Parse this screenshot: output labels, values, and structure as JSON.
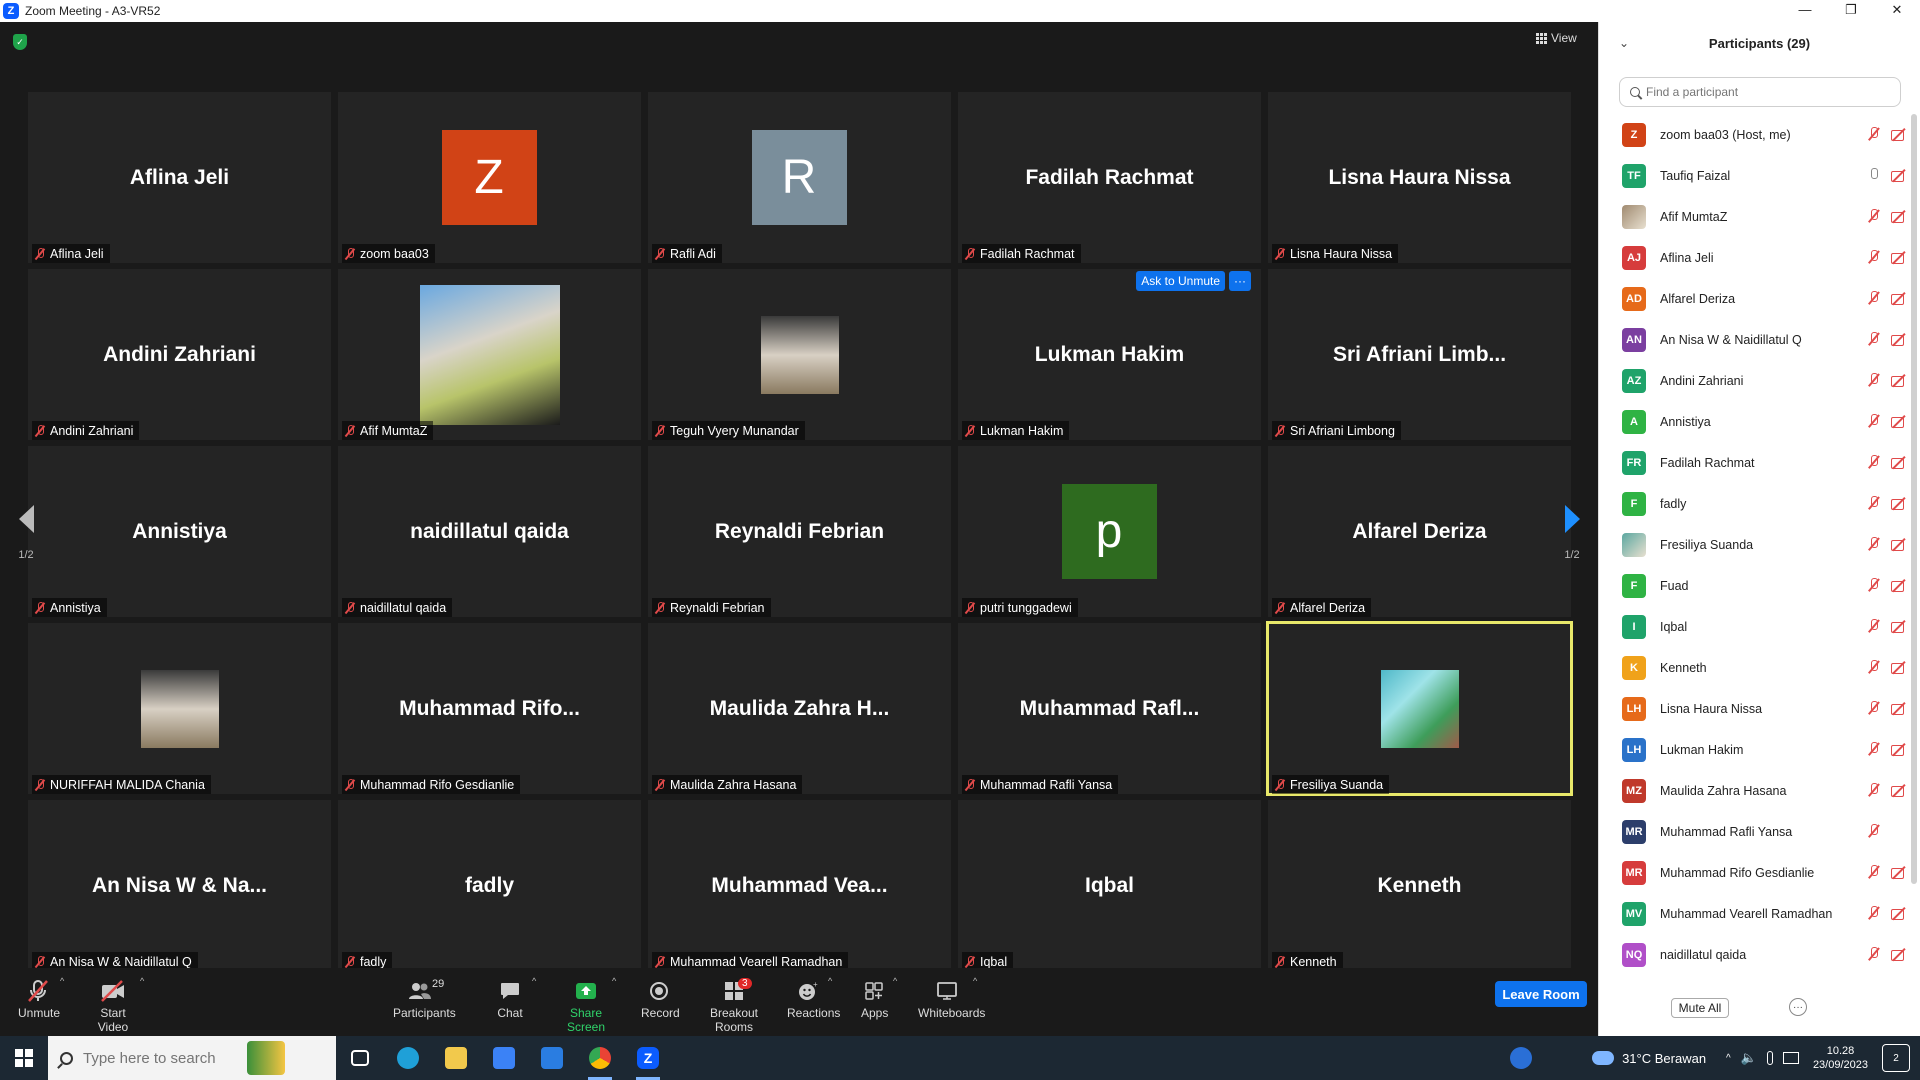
{
  "window": {
    "title": "Zoom Meeting - A3-VR52",
    "controls": [
      "—",
      "❐",
      "✕"
    ]
  },
  "view_label": "View",
  "tiles": [
    {
      "display": "Aflina Jeli",
      "label": "Aflina Jeli",
      "kind": "text"
    },
    {
      "display": "Z",
      "label": "zoom baa03",
      "kind": "avatar",
      "color": "#d14316"
    },
    {
      "display": "R",
      "label": "Rafli Adi",
      "kind": "avatar",
      "color": "#7a8e9b"
    },
    {
      "display": "Fadilah Rachmat",
      "label": "Fadilah Rachmat",
      "kind": "text"
    },
    {
      "display": "Lisna Haura Nissa",
      "label": "Lisna Haura Nissa",
      "kind": "text"
    },
    {
      "display": "Andini Zahriani",
      "label": "Andini Zahriani",
      "kind": "text"
    },
    {
      "display": "",
      "label": "Afif MumtaZ",
      "kind": "photo-large"
    },
    {
      "display": "",
      "label": "Teguh Vyery Munandar",
      "kind": "photo"
    },
    {
      "display": "Lukman Hakim",
      "label": "Lukman Hakim",
      "kind": "text",
      "ask": true
    },
    {
      "display": "Sri  Afriani  Limb...",
      "label": "Sri Afriani Limbong",
      "kind": "text"
    },
    {
      "display": "Annistiya",
      "label": "Annistiya",
      "kind": "text"
    },
    {
      "display": "naidillatul qaida",
      "label": "naidillatul qaida",
      "kind": "text"
    },
    {
      "display": "Reynaldi Febrian",
      "label": "Reynaldi Febrian",
      "kind": "text"
    },
    {
      "display": "p",
      "label": "putri tunggadewi",
      "kind": "avatar",
      "color": "#2e6b1f"
    },
    {
      "display": "Alfarel Deriza",
      "label": "Alfarel Deriza",
      "kind": "text"
    },
    {
      "display": "",
      "label": "NURIFFAH MALIDA Chania",
      "kind": "photo"
    },
    {
      "display": "Muhammad  Rifo...",
      "label": "Muhammad Rifo Gesdianlie",
      "kind": "text"
    },
    {
      "display": "Maulida  Zahra  H...",
      "label": "Maulida Zahra Hasana",
      "kind": "text"
    },
    {
      "display": "Muhammad  Rafl...",
      "label": "Muhammad Rafli Yansa",
      "kind": "text"
    },
    {
      "display": "",
      "label": "Fresiliya Suanda",
      "kind": "photo-landscape",
      "active": true
    },
    {
      "display": "An Nisa W & Na...",
      "label": "An Nisa W & Naidillatul Q",
      "kind": "text"
    },
    {
      "display": "fadly",
      "label": "fadly",
      "kind": "text"
    },
    {
      "display": "Muhammad  Vea...",
      "label": "Muhammad Vearell Ramadhan",
      "kind": "text"
    },
    {
      "display": "Iqbal",
      "label": "Iqbal",
      "kind": "text"
    },
    {
      "display": "Kenneth",
      "label": "Kenneth",
      "kind": "text"
    }
  ],
  "ask_to_unmute": "Ask to Unmute",
  "ask_more": "···",
  "pager": {
    "left": "1/2",
    "right": "1/2"
  },
  "toolbar": {
    "unmute": "Unmute",
    "start_video": "Start Video",
    "participants": "Participants",
    "participants_count": "29",
    "chat": "Chat",
    "share_screen": "Share Screen",
    "record": "Record",
    "breakout_rooms": "Breakout Rooms",
    "breakout_badge": "3",
    "reactions": "Reactions",
    "apps": "Apps",
    "whiteboards": "Whiteboards",
    "leave_room": "Leave Room"
  },
  "panel": {
    "title": "Participants (29)",
    "search_placeholder": "Find a participant",
    "mute_all": "Mute All",
    "more": "···",
    "participants": [
      {
        "initials": "Z",
        "name": "zoom baa03 (Host, me)",
        "color": "#d14316",
        "mic": "off",
        "cam": "off"
      },
      {
        "initials": "TF",
        "name": "Taufiq Faizal",
        "color": "#1fa36a",
        "mic": "on",
        "cam": "off"
      },
      {
        "initials": "",
        "name": "Afif MumtaZ",
        "color": "#a08a70",
        "mic": "off",
        "cam": "off"
      },
      {
        "initials": "AJ",
        "name": "Aflina Jeli",
        "color": "#d63c3c",
        "mic": "off",
        "cam": "off"
      },
      {
        "initials": "AD",
        "name": "Alfarel Deriza",
        "color": "#e66a1a",
        "mic": "off",
        "cam": "off"
      },
      {
        "initials": "AN",
        "name": "An Nisa W & Naidillatul Q",
        "color": "#7b3fa0",
        "mic": "off",
        "cam": "off"
      },
      {
        "initials": "AZ",
        "name": "Andini Zahriani",
        "color": "#1fa36a",
        "mic": "off",
        "cam": "off"
      },
      {
        "initials": "A",
        "name": "Annistiya",
        "color": "#2fb344",
        "mic": "off",
        "cam": "off"
      },
      {
        "initials": "FR",
        "name": "Fadilah Rachmat",
        "color": "#1fa36a",
        "mic": "off",
        "cam": "off"
      },
      {
        "initials": "F",
        "name": "fadly",
        "color": "#2fb344",
        "mic": "off",
        "cam": "off"
      },
      {
        "initials": "",
        "name": "Fresiliya Suanda",
        "color": "#5aa7a0",
        "mic": "off",
        "cam": "off"
      },
      {
        "initials": "F",
        "name": "Fuad",
        "color": "#2fb344",
        "mic": "off",
        "cam": "off"
      },
      {
        "initials": "I",
        "name": "Iqbal",
        "color": "#1fa36a",
        "mic": "off",
        "cam": "off"
      },
      {
        "initials": "K",
        "name": "Kenneth",
        "color": "#f0a21a",
        "mic": "off",
        "cam": "off"
      },
      {
        "initials": "LH",
        "name": "Lisna Haura Nissa",
        "color": "#e66a1a",
        "mic": "off",
        "cam": "off"
      },
      {
        "initials": "LH",
        "name": "Lukman Hakim",
        "color": "#2a72c9",
        "mic": "off",
        "cam": "off"
      },
      {
        "initials": "MZ",
        "name": "Maulida Zahra Hasana",
        "color": "#c0392b",
        "mic": "off",
        "cam": "off"
      },
      {
        "initials": "MR",
        "name": "Muhammad Rafli Yansa",
        "color": "#2c3e6b",
        "mic": "off",
        "cam": "none"
      },
      {
        "initials": "MR",
        "name": "Muhammad Rifo Gesdianlie",
        "color": "#d63c3c",
        "mic": "off",
        "cam": "off"
      },
      {
        "initials": "MV",
        "name": "Muhammad Vearell Ramadhan",
        "color": "#1fa36a",
        "mic": "off",
        "cam": "off"
      },
      {
        "initials": "NQ",
        "name": "naidillatul qaida",
        "color": "#b04fc8",
        "mic": "off",
        "cam": "off"
      }
    ]
  },
  "taskbar": {
    "search_placeholder": "Type here to search",
    "weather": "31°C  Berawan",
    "time": "10.28",
    "date": "23/09/2023",
    "notifications": "2"
  }
}
